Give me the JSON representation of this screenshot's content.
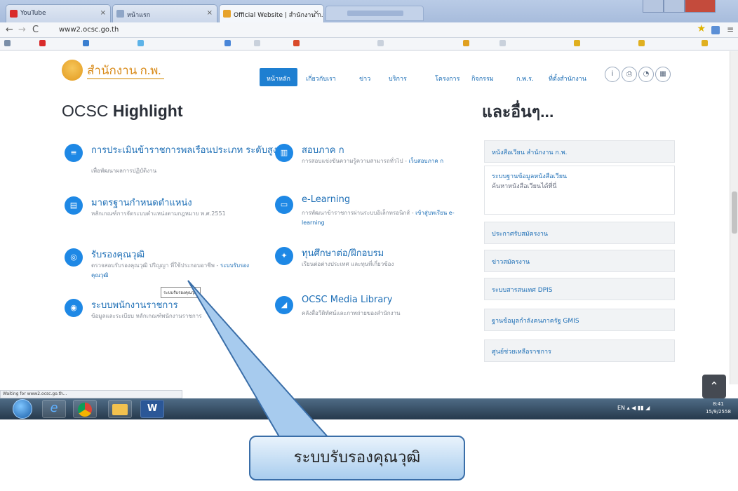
{
  "browser": {
    "tabs": [
      "YouTube",
      "หน้าแรก",
      "Official Website | สำนักงาน ก.พ."
    ],
    "url": "www2.ocsc.go.th"
  },
  "site": {
    "logo_text": "สำนักงาน ก.พ.",
    "nav": [
      "หน้าหลัก",
      "เกี่ยวกับเรา",
      "ข่าว",
      "บริการ",
      "โครงการ",
      "กิจกรรม",
      "ก.พ.ร.",
      "ที่ตั้งสำนักงาน"
    ],
    "social_icons": [
      "info-icon",
      "print-icon",
      "rss-icon",
      "sitemap-icon"
    ]
  },
  "highlight": {
    "title_plain": "OCSC ",
    "title_bold": "Highlight",
    "items": [
      {
        "icon": "list-icon",
        "title": "การประเมินข้าราชการพลเรือนประเภท ระดับสูง",
        "desc": "เพื่อพัฒนาผลการปฏิบัติงาน",
        "link": ""
      },
      {
        "icon": "document-icon",
        "title": "มาตรฐานกำหนดตำแหน่ง",
        "desc": "หลักเกณฑ์การจัดระบบตำแหน่งตามกฎหมาย พ.ศ.2551",
        "link": ""
      },
      {
        "icon": "qualification-icon",
        "title": "รับรองคุณวุฒิ",
        "desc": "ตรวจสอบรับรองคุณวุฒิ ปริญญา ที่ใช้ประกอบอาชีพ -",
        "link": "ระบบรับรองคุณวุฒิ"
      },
      {
        "icon": "system-icon",
        "title": "ระบบพนักงานราชการ",
        "desc": "ข้อมูลและระเบียบ หลักเกณฑ์พนักงานราชการ",
        "link": ""
      },
      {
        "icon": "trash-icon",
        "title": "สอบภาค ก",
        "desc": "การสอบแข่งขันความรู้ความสามารถทั่วไป -",
        "link": "เว็บสอบภาค ก"
      },
      {
        "icon": "elearning-icon",
        "title": "e-Learning",
        "desc": "การพัฒนาข้าราชการผ่านระบบอิเล็กทรอนิกส์ -",
        "link": "เข้าสู่บทเรียน e-learning"
      },
      {
        "icon": "scholarship-icon",
        "title": "ทุนศึกษาต่อ/ฝึกอบรม",
        "desc": "เรียนต่อต่างประเทศ และทุนที่เกี่ยวข้อง",
        "link": ""
      },
      {
        "icon": "library-icon",
        "title": "OCSC Media Library",
        "desc": "คลังสื่อวีดิทัศน์และภาพถ่ายของสำนักงาน",
        "link": ""
      }
    ],
    "tooltip": "ระบบรับรองคุณวุฒิ"
  },
  "sidebar": {
    "title": "และอื่นๆ...",
    "items": [
      "หนังสือเวียน สำนักงาน ก.พ.",
      "ระบบฐานข้อมูลหนังสือเวียน",
      "ประกาศรับสมัครงาน",
      "ข่าวสมัครงาน",
      "ระบบสารสนเทศ DPIS",
      "ฐานข้อมูลกำลังคนภาครัฐ GMIS",
      "ศูนย์ช่วยเหลือราชการ"
    ],
    "note": "ค้นหาหนังสือเวียนได้ที่นี่"
  },
  "taskbar": {
    "apps": [
      "start-orb",
      "ie-icon",
      "chrome-icon",
      "folder-icon",
      "word-icon"
    ],
    "time": "8:41",
    "date": "15/9/2558"
  },
  "status_text": "Waiting for www2.ocsc.go.th...",
  "callout": {
    "text": "ระบบรับรองคุณวุฒิ"
  }
}
